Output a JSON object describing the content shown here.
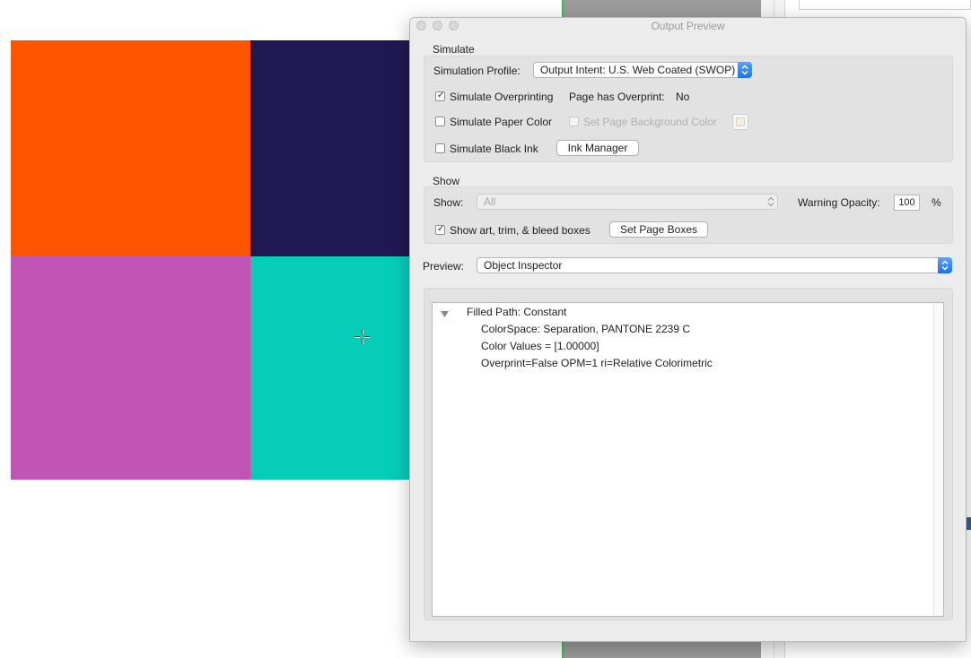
{
  "canvas": {
    "swatch_colors": {
      "top_left": "#ff5500",
      "top_right": "#201852",
      "bottom_left": "#c055b6",
      "bottom_right": "#06cdb8"
    },
    "cursor": "crosshair-icon"
  },
  "window": {
    "title": "Output Preview",
    "controls": [
      "close-button",
      "minimize-button",
      "zoom-button"
    ]
  },
  "simulate": {
    "section_title": "Simulate",
    "profile_label": "Simulation Profile:",
    "profile_value": "Output Intent: U.S. Web Coated (SWOP) v2",
    "overprinting_label": "Simulate Overprinting",
    "overprinting_checked": true,
    "page_has_overprint_label": "Page has Overprint:",
    "page_has_overprint_value": "No",
    "paper_color_label": "Simulate Paper Color",
    "paper_color_checked": false,
    "set_bg_label": "Set Page Background Color",
    "set_bg_enabled": false,
    "black_ink_label": "Simulate Black Ink",
    "black_ink_checked": false,
    "ink_manager_label": "Ink Manager"
  },
  "show": {
    "section_title": "Show",
    "show_label": "Show:",
    "show_value": "All",
    "warning_opacity_label": "Warning Opacity:",
    "warning_opacity_value": "100",
    "percent_sign": "%",
    "boxes_label": "Show art, trim, & bleed boxes",
    "boxes_checked": true,
    "set_page_boxes_label": "Set Page Boxes"
  },
  "preview": {
    "label": "Preview:",
    "value": "Object Inspector"
  },
  "inspector": {
    "root": "Filled Path: Constant",
    "children": [
      "ColorSpace: Separation, PANTONE 2239 C",
      "Color Values = [1.00000]",
      "Overprint=False OPM=1 ri=Relative Colorimetric"
    ]
  }
}
